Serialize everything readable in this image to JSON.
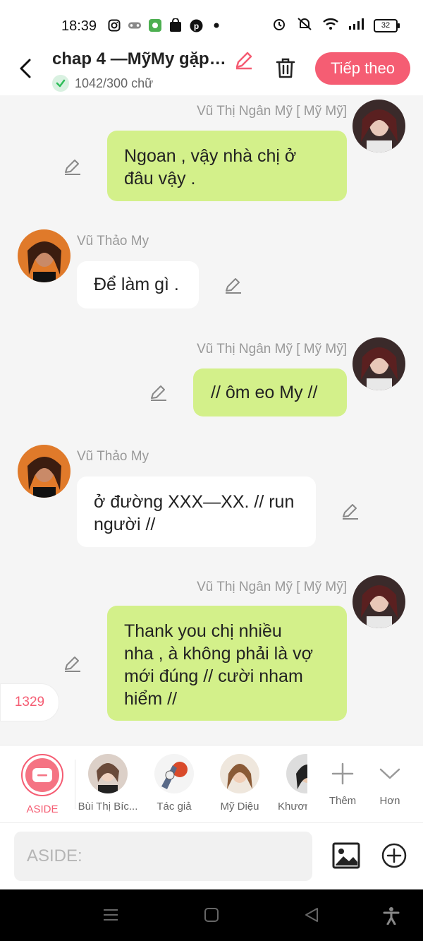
{
  "status_bar": {
    "time": "18:39",
    "battery": "32"
  },
  "header": {
    "title": "chap 4 —MỹMy gặp…",
    "word_count": "1042/300 chữ",
    "next_button": "Tiếp theo"
  },
  "messages": [
    {
      "speaker": "Vũ Thị Ngân Mỹ [ Mỹ Mỹ]",
      "side": "right",
      "lines": [
        "Ngoan , vậy nhà chị ở",
        "đâu vậy ."
      ]
    },
    {
      "speaker": "Vũ Thảo My",
      "side": "left",
      "lines": [
        "Để làm gì ."
      ]
    },
    {
      "speaker": "Vũ Thị Ngân Mỹ [ Mỹ Mỹ]",
      "side": "right",
      "lines": [
        "// ôm eo My //"
      ]
    },
    {
      "speaker": "Vũ Thảo My",
      "side": "left",
      "lines": [
        "ở đường XXX—XX. // run",
        "người //"
      ]
    },
    {
      "speaker": "Vũ Thị Ngân Mỹ [ Mỹ Mỹ]",
      "side": "right",
      "lines": [
        "Thank you chị nhiều",
        "nha , à không phải là vợ",
        "mới đúng // cười nham",
        "hiểm //"
      ]
    }
  ],
  "counter": "1329",
  "characters": [
    {
      "label": "ASIDE"
    },
    {
      "label": "Bùi Thị Bíc..."
    },
    {
      "label": "Tác giả"
    },
    {
      "label": "Mỹ Diệu"
    },
    {
      "label": "Khươn"
    }
  ],
  "actions": {
    "add_label": "Thêm",
    "more_label": "Hơn"
  },
  "input": {
    "placeholder": "ASIDE:"
  },
  "colors": {
    "accent": "#f55d73",
    "green_bubble": "#d3f08a",
    "white_bubble": "#ffffff"
  },
  "icons": [
    "back-arrow-icon",
    "edit-pen-icon",
    "trash-icon",
    "image-icon",
    "plus-circle-icon",
    "menu-icon",
    "home-icon",
    "nav-back-icon",
    "accessibility-icon"
  ]
}
